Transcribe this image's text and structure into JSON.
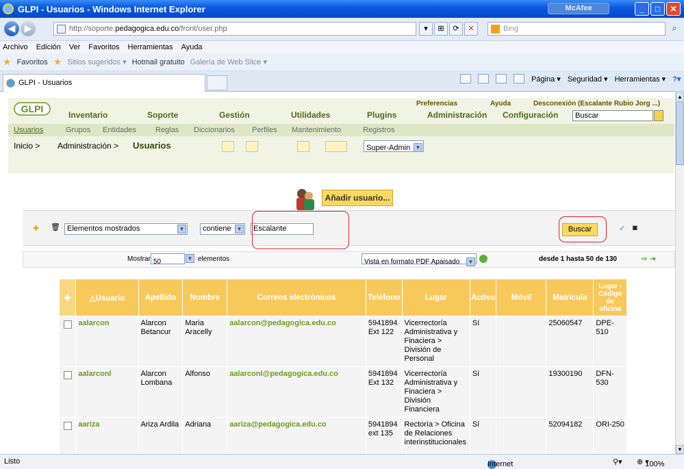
{
  "window": {
    "title": "GLPI - Usuarios - Windows Internet Explorer",
    "mcafee": "McAfee"
  },
  "address": {
    "url_prefix": "http://soporte.",
    "url_domain": "pedagogica.edu.co",
    "url_suffix": "/front/user.php",
    "search_placeholder": "Bing"
  },
  "menu": [
    "Archivo",
    "Edición",
    "Ver",
    "Favoritos",
    "Herramientas",
    "Ayuda"
  ],
  "favorites": {
    "label": "Favoritos",
    "items": [
      "Sitios sugeridos ▾",
      "Hotmail gratuito",
      "Galería de Web Slice ▾"
    ]
  },
  "tab": {
    "label": "GLPI - Usuarios"
  },
  "commands": [
    "Página ▾",
    "Seguridad ▾",
    "Herramientas ▾"
  ],
  "glpi": {
    "logo": "GLPI",
    "top": {
      "preferences": "Preferencias",
      "help": "Ayuda",
      "logout": "Desconexión (Escalante Rubio Jorg ...)"
    },
    "main_menu": [
      "Inventario",
      "Soporte",
      "Gestión",
      "Utilidades",
      "Plugins",
      "Administración",
      "Configuración"
    ],
    "search_value": "Buscar",
    "submenu": [
      "Usuarios",
      "Grupos",
      "Entidades",
      "Reglas",
      "Diccionarios",
      "Perfiles",
      "Mantenimiento",
      "Registros"
    ],
    "breadcrumb": [
      "Inicio >",
      "Administración >"
    ],
    "page_title": "Usuarios",
    "profile": "Super-Admin"
  },
  "add_user": "Añadir usuario...",
  "search": {
    "field": "Elementos mostrados",
    "operator": "contiene",
    "value": "Escalante",
    "button": "Buscar"
  },
  "pager": {
    "show_label": "Mostrar",
    "count": "50",
    "elements_label": "elementos",
    "export": "Vista en formato PDF Apaisado",
    "range": "desde 1 hasta 50 de 130"
  },
  "table": {
    "headers": [
      "△Usuario",
      "Apellido",
      "Nombre",
      "Correos electrónicos",
      "Teléfono",
      "Lugar",
      "Activo",
      "Móvil",
      "Matrícula",
      "Lugar - Código de oficina"
    ],
    "rows": [
      {
        "user": "aalarcon",
        "surname": "Alarcon Betancur",
        "name": "Maria Aracelly",
        "email": "aalarcon@pedagogica.edu.co",
        "phone": "5941894 Ext 122",
        "place": "Vicerrectoría Administrativa y Finaciera > División de Personal",
        "active": "Sí",
        "mobile": "",
        "reg": "25060547",
        "office": "DPE-510"
      },
      {
        "user": "aalarconl",
        "surname": "Alarcon Lombana",
        "name": "Alfonso",
        "email": "aalarconl@pedagogica.edu.co",
        "phone": "5941894 Ext 132",
        "place": "Vicerrectoría Administrativa y Finaciera > División Financiera",
        "active": "Sí",
        "mobile": "",
        "reg": "19300190",
        "office": "DFN-530"
      },
      {
        "user": "aariza",
        "surname": "Ariza Ardila",
        "name": "Adriana",
        "email": "aariza@pedagogica.edu.co",
        "phone": "5941894 ext 135",
        "place": "Rectoría > Oficina de Relaciones interinstitucionales",
        "active": "Sí",
        "mobile": "",
        "reg": "52094182",
        "office": "ORI-250"
      }
    ]
  },
  "status": {
    "left": "Listo",
    "zone": "Internet",
    "zoom": "100%"
  }
}
